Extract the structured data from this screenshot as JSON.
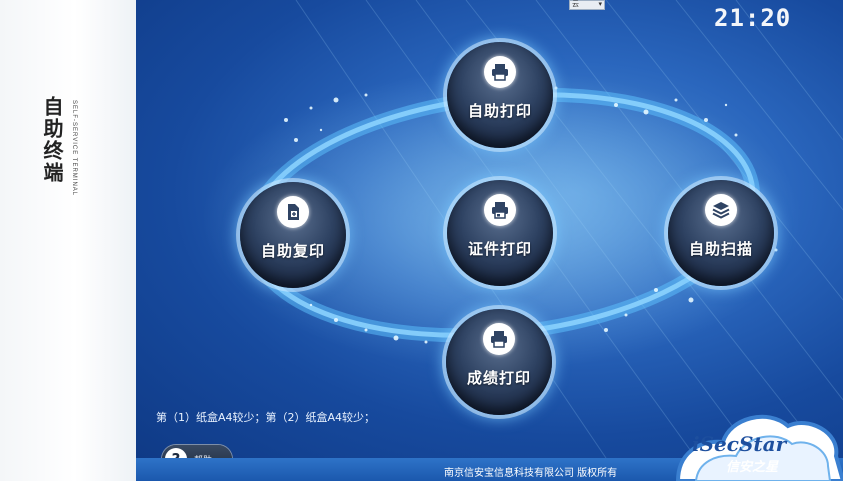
{
  "sidebar": {
    "title": "自助终端",
    "subtitle": "SELF-SERVICE TERMINAL"
  },
  "header": {
    "language_select": "云",
    "clock": "21:20"
  },
  "menu": {
    "print": {
      "label": "自助打印",
      "icon": "printer-icon"
    },
    "copy": {
      "label": "自助复印",
      "icon": "copy-document-icon"
    },
    "id_print": {
      "label": "证件打印",
      "icon": "id-card-printer-icon"
    },
    "scan": {
      "label": "自助扫描",
      "icon": "layers-scan-icon"
    },
    "grade_print": {
      "label": "成绩打印",
      "icon": "printer-icon"
    }
  },
  "status": {
    "message": "第（1）纸盒A4较少；第（2）纸盒A4较少；"
  },
  "footer": {
    "help_label": "帮助",
    "copyright": "南京信安宝信息科技有限公司   版权所有"
  },
  "logo": {
    "name": "iSecStar",
    "name_cn": "信安之星"
  },
  "colors": {
    "accent": "#2a66bd",
    "button_dark": "#17243d",
    "glow": "#78c8ff"
  }
}
